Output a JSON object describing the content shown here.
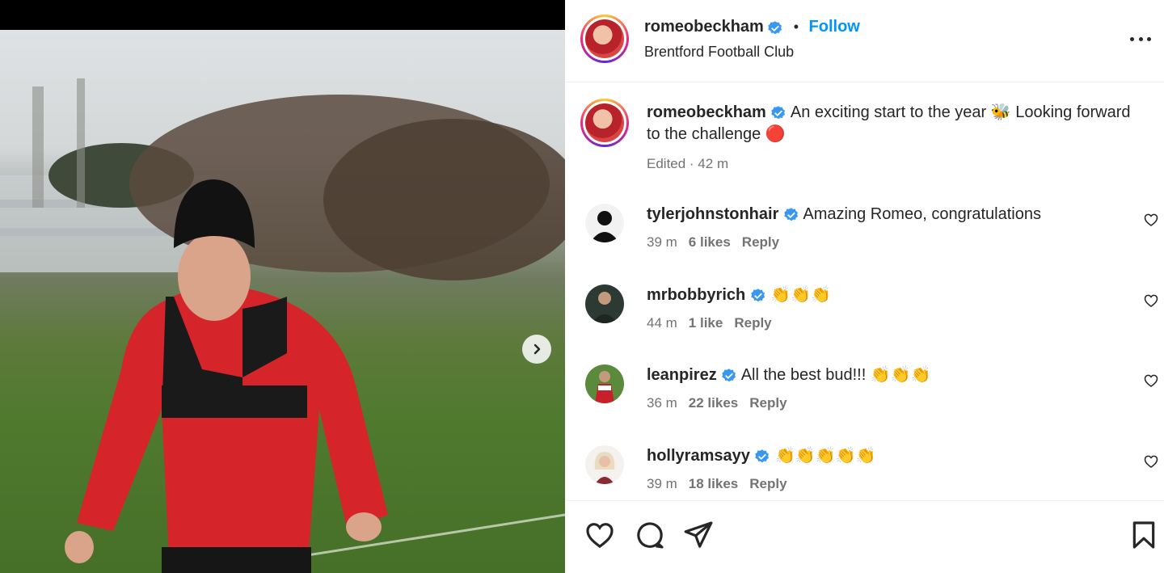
{
  "post": {
    "username": "romeobeckham",
    "location": "Brentford Football Club",
    "follow_label": "Follow",
    "dot": "•",
    "caption": "An exciting start to the year 🐝 Looking forward to the challenge 🔴",
    "edited_label": "Edited · 42 m"
  },
  "comments": [
    {
      "username": "tyler johnstonhair",
      "user": "tylerjohnstonhair",
      "text": "Amazing Romeo, congratulations",
      "time": "39 m",
      "likes": "6 likes",
      "reply": "Reply"
    },
    {
      "user": "mrbobbyrich",
      "text": "👏👏👏",
      "time": "44 m",
      "likes": "1 like",
      "reply": "Reply"
    },
    {
      "user": "leanpirez",
      "text": "All the best bud!!! 👏👏👏",
      "time": "36 m",
      "likes": "22 likes",
      "reply": "Reply"
    },
    {
      "user": "hollyramsayy",
      "text": "👏👏👏👏👏",
      "time": "39 m",
      "likes": "18 likes",
      "reply": "Reply"
    }
  ],
  "icons": {
    "verified_color": "#3897f0",
    "follow_color": "#0095f6"
  }
}
